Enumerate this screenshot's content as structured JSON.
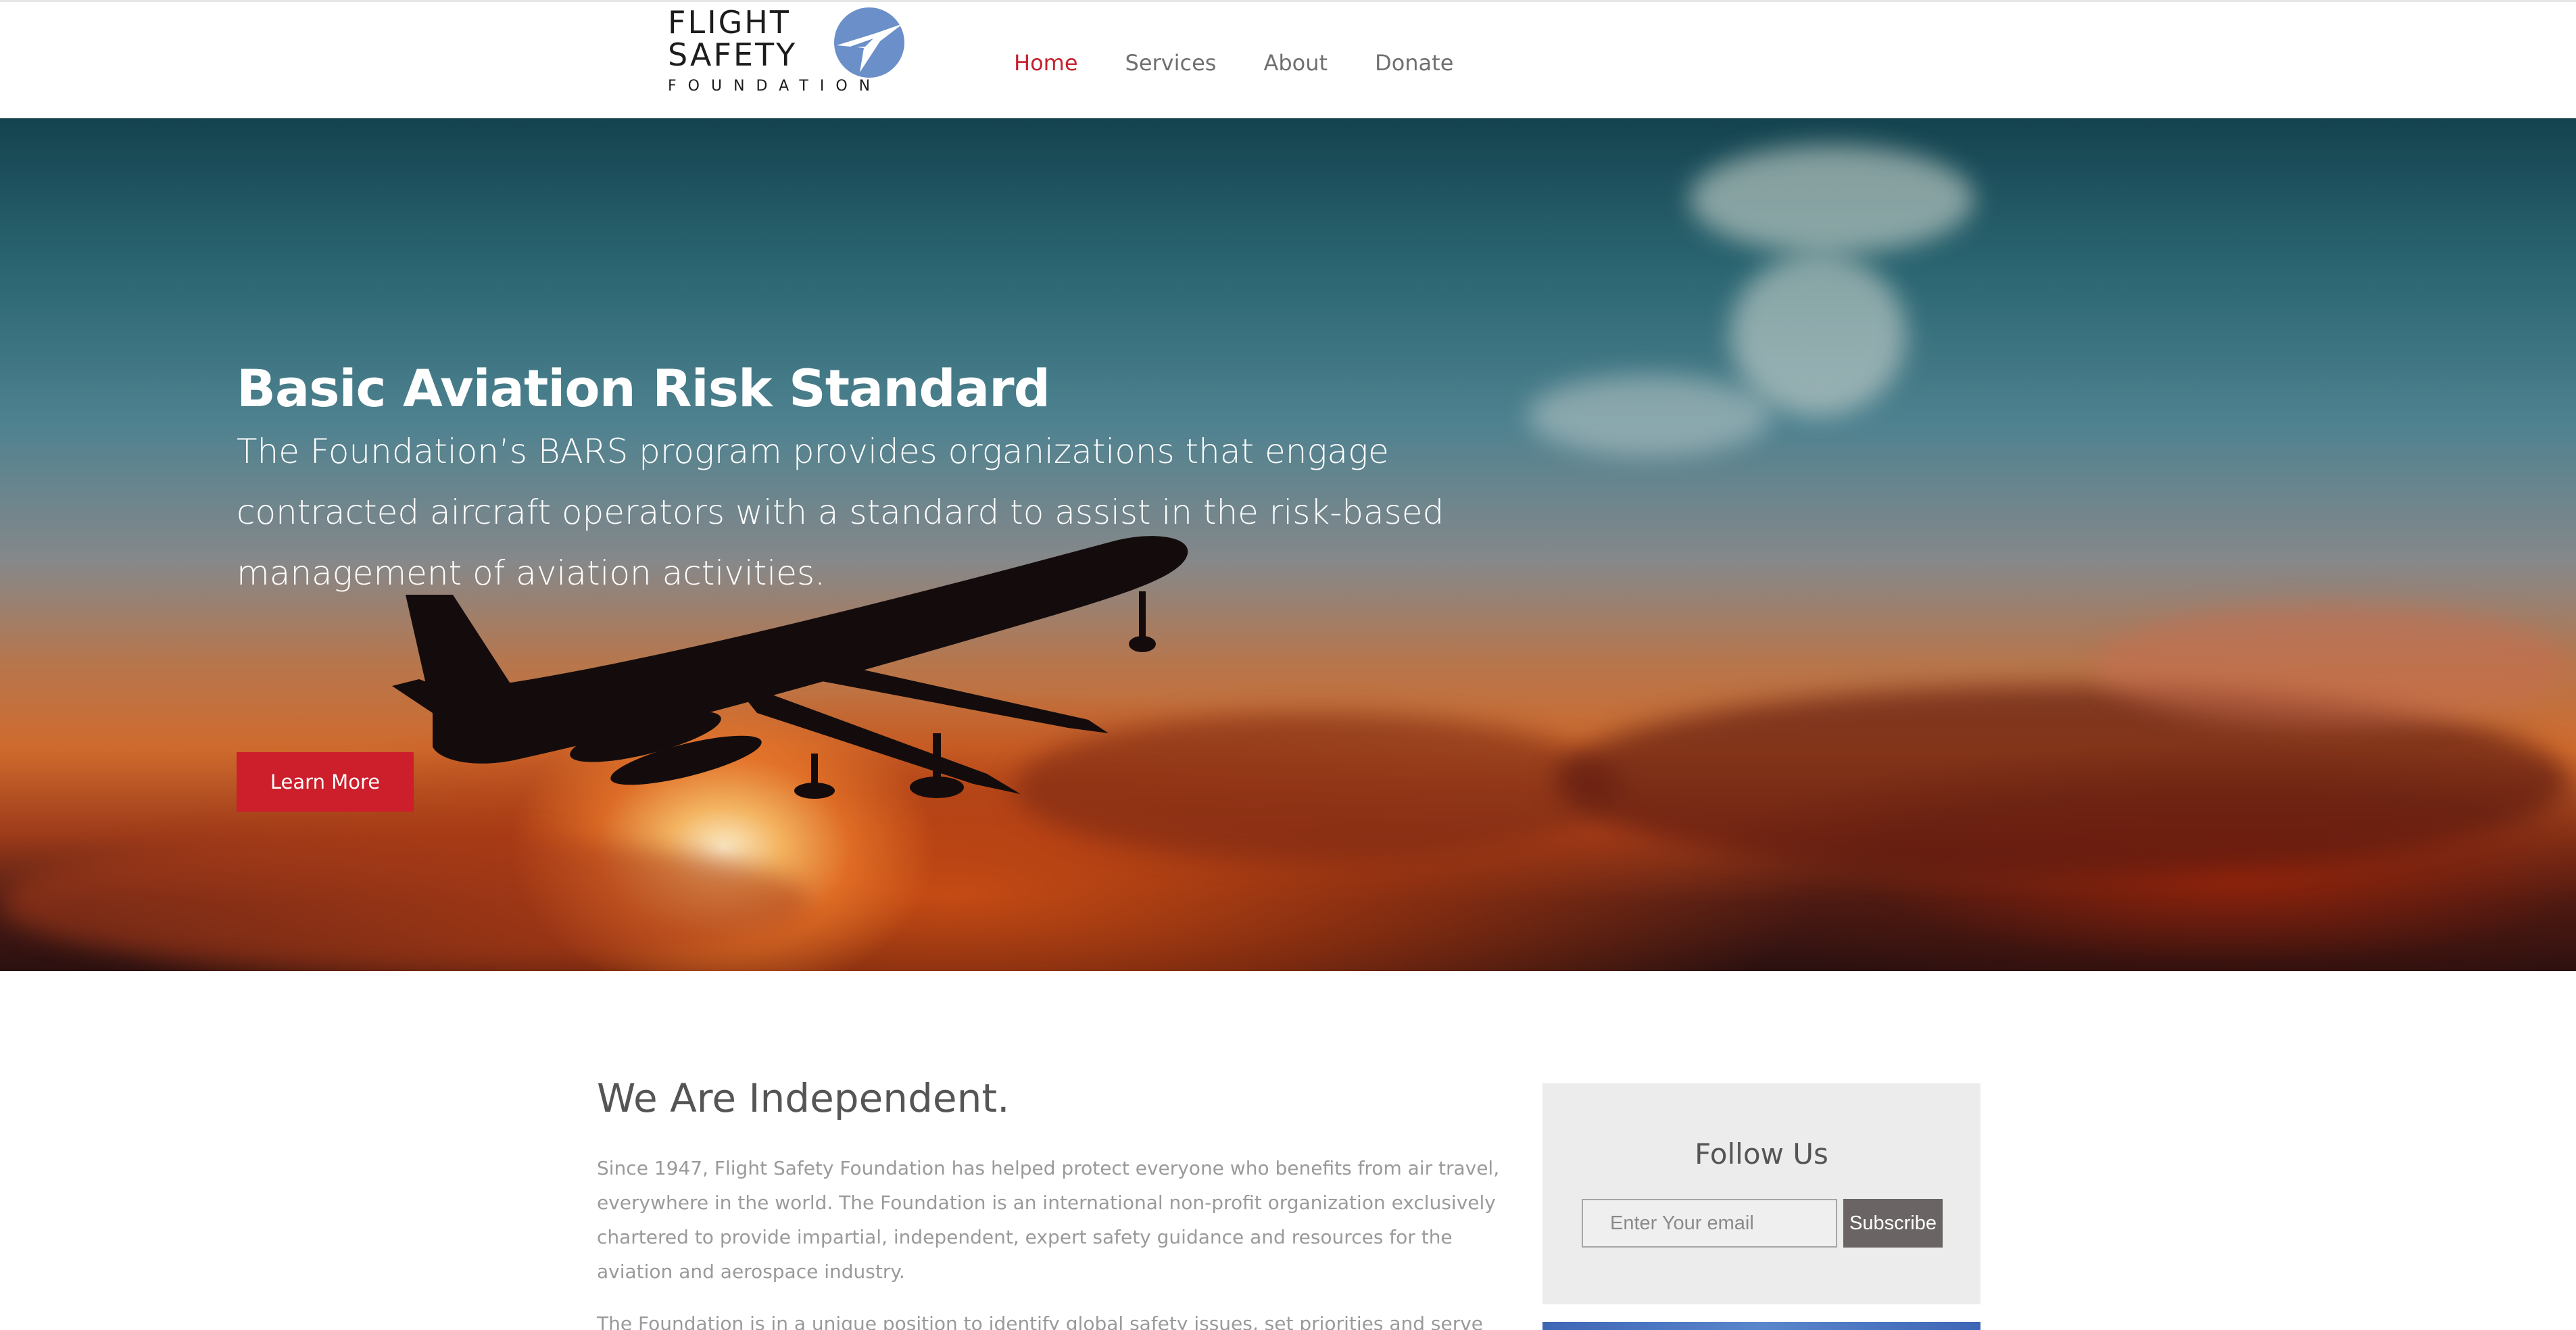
{
  "header": {
    "logo": {
      "line1": "FLIGHT",
      "line2": "SAFETY",
      "line3": "FOUNDATION",
      "mark_icon": "globe-plane-icon",
      "mark_color": "#6b8fc8"
    },
    "nav": [
      {
        "label": "Home",
        "active": true
      },
      {
        "label": "Services",
        "active": false
      },
      {
        "label": "About",
        "active": false
      },
      {
        "label": "Donate",
        "active": false
      }
    ],
    "active_color": "#c4212f"
  },
  "hero": {
    "title": "Basic Aviation Risk Standard",
    "text": "The Foundation’s BARS program provides organizations that engage contracted aircraft operators with a standard to assist in the risk-based management of aviation activities.",
    "button_label": "Learn More",
    "button_color": "#cc1e2b",
    "background_icon": "airplane-sunset-image"
  },
  "main": {
    "title": "We Are Independent.",
    "paragraph1": "Since 1947, Flight Safety Foundation has helped protect everyone who benefits from air travel, everywhere in the world. The Foundation is an international non-profit organization exclusively chartered to provide impartial, independent, expert safety guidance and resources for the aviation and aerospace industry.",
    "paragraph2": "The Foundation is in a unique position to identify global safety issues, set priorities and serve as a catalyst"
  },
  "sidebar": {
    "follow_title": "Follow Us",
    "email_placeholder": "Enter Your email",
    "subscribe_label": "Subscribe"
  }
}
